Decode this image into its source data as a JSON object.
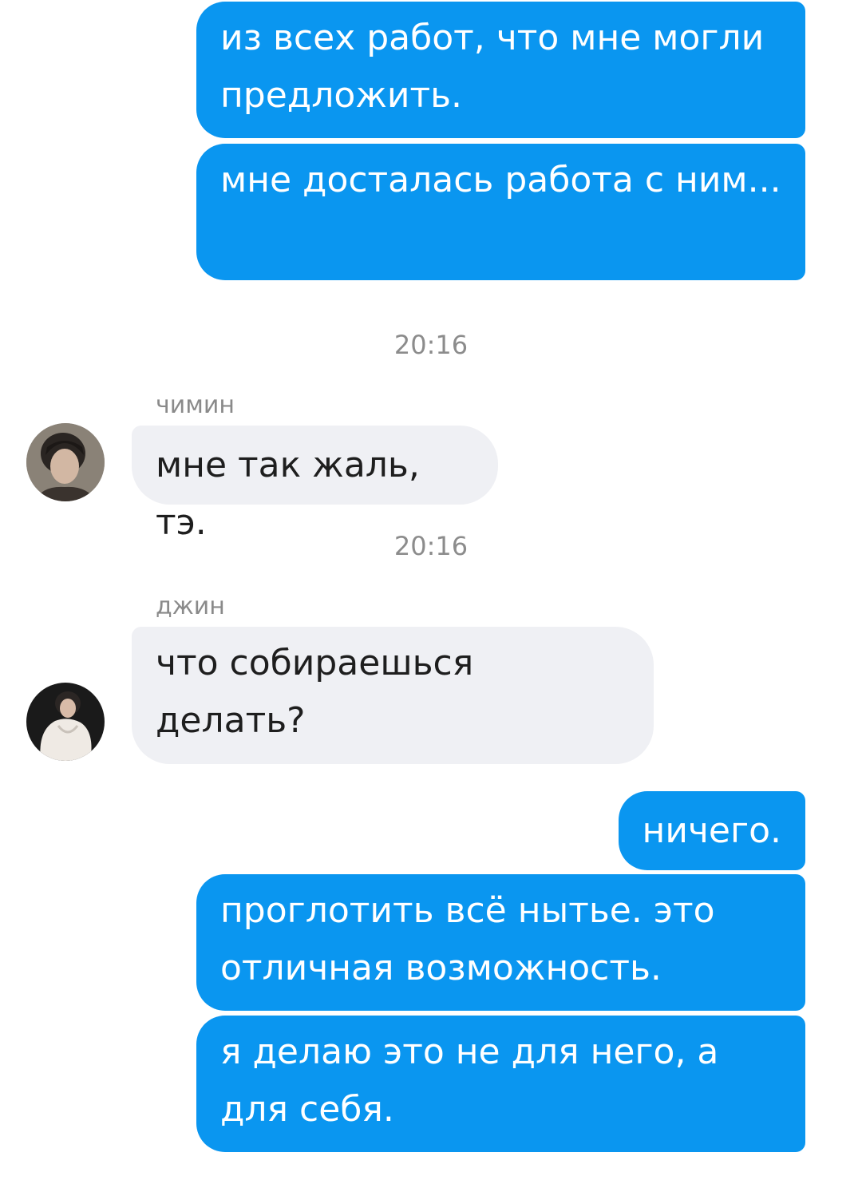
{
  "messages": {
    "m1": "из всех работ, что мне могли предложить.",
    "m2": "мне досталась работа с ним...",
    "t1": "20:16",
    "jimin_name": "чимин",
    "m3": "мне так жаль, тэ.",
    "t2": "20:16",
    "jin_name": "джин",
    "m4": "что собираешься делать?",
    "m5": "ничего.",
    "m6": "проглотить всё нытье. это отличная возможность.",
    "m7": "я делаю это не для него, а для себя."
  },
  "colors": {
    "outgoing_bubble": "#0a96f0",
    "incoming_bubble": "#eff0f4",
    "timestamp": "#8c8c8c"
  },
  "icons": {
    "jimin_avatar": "user-photo-avatar",
    "jin_avatar": "user-photo-avatar"
  }
}
